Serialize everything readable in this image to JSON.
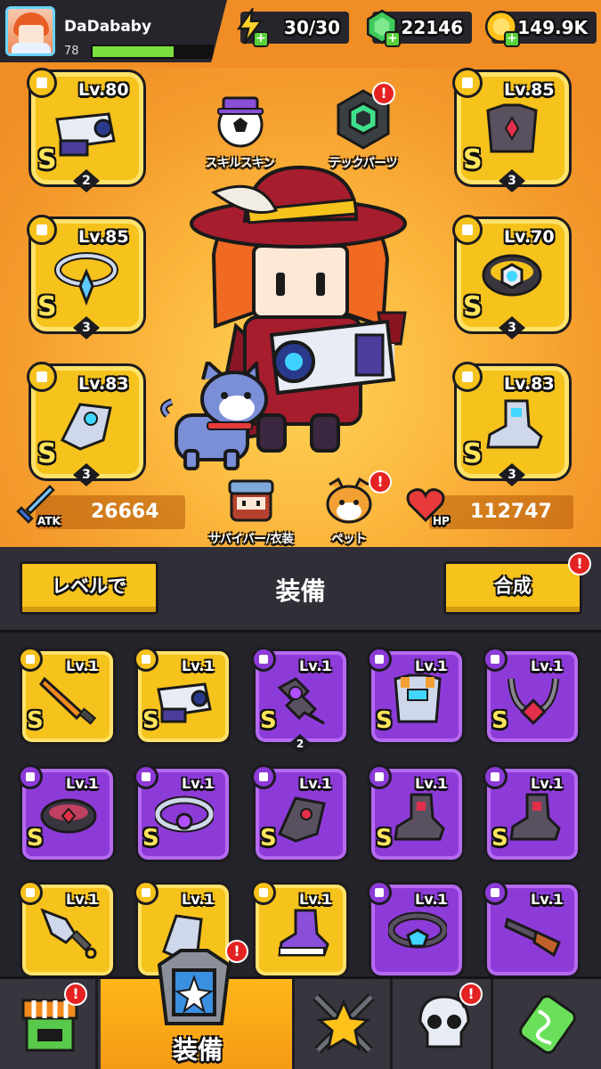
{
  "player": {
    "name": "DaDababy",
    "level": "78",
    "xp_fraction": 0.68
  },
  "currencies": {
    "energy": "30/30",
    "gems": "22146",
    "gold": "149.9K"
  },
  "equipped": [
    {
      "slot": "weapon",
      "level": "Lv.80",
      "grade": "S",
      "stars": "2",
      "item_icon": "blaster-gun-icon"
    },
    {
      "slot": "armor",
      "level": "Lv.85",
      "grade": "S",
      "stars": "3",
      "item_icon": "dark-armor-icon"
    },
    {
      "slot": "necklace",
      "level": "Lv.85",
      "grade": "S",
      "stars": "3",
      "item_icon": "star-necklace-icon"
    },
    {
      "slot": "belt",
      "level": "Lv.70",
      "grade": "S",
      "stars": "3",
      "item_icon": "tech-belt-icon"
    },
    {
      "slot": "gloves",
      "level": "Lv.83",
      "grade": "S",
      "stars": "3",
      "item_icon": "mech-glove-icon"
    },
    {
      "slot": "boots",
      "level": "Lv.83",
      "grade": "S",
      "stars": "3",
      "item_icon": "tech-boots-icon"
    }
  ],
  "hud": {
    "skill_skin": "スキルスキン",
    "tech_parts": "テックパーツ",
    "survivor_costume": "サバイバー/衣装",
    "pet": "ペット",
    "alert": "!"
  },
  "stats": {
    "atk_label": "ATK",
    "atk": "26664",
    "hp_label": "HP",
    "hp": "112747"
  },
  "midbar": {
    "level_button": "レベルで",
    "title": "装備",
    "merge_button": "合成"
  },
  "inventory": [
    {
      "rarity": "gold",
      "level": "Lv.1",
      "grade": "S",
      "item_icon": "katana-icon"
    },
    {
      "rarity": "gold",
      "level": "Lv.1",
      "grade": "S",
      "item_icon": "blaster-gun-icon"
    },
    {
      "rarity": "purple",
      "level": "Lv.1",
      "grade": "S",
      "stars": "2",
      "item_icon": "spiked-blade-icon"
    },
    {
      "rarity": "purple",
      "level": "Lv.1",
      "grade": "S",
      "item_icon": "mech-armor-icon"
    },
    {
      "rarity": "purple",
      "level": "Lv.1",
      "grade": "S",
      "item_icon": "chain-necklace-icon"
    },
    {
      "rarity": "purple",
      "level": "Lv.1",
      "grade": "S",
      "item_icon": "dark-belt-icon"
    },
    {
      "rarity": "purple",
      "level": "Lv.1",
      "grade": "S",
      "item_icon": "gem-belt-icon"
    },
    {
      "rarity": "purple",
      "level": "Lv.1",
      "grade": "S",
      "item_icon": "claw-glove-icon"
    },
    {
      "rarity": "purple",
      "level": "Lv.1",
      "grade": "S",
      "item_icon": "dark-boots-icon"
    },
    {
      "rarity": "purple",
      "level": "Lv.1",
      "grade": "S",
      "item_icon": "dark-boots-icon"
    },
    {
      "rarity": "gold",
      "level": "Lv.1",
      "grade": "",
      "item_icon": "kunai-icon"
    },
    {
      "rarity": "gold",
      "level": "Lv.1",
      "grade": "",
      "item_icon": "metal-glove-icon"
    },
    {
      "rarity": "gold",
      "level": "Lv.1",
      "grade": "",
      "item_icon": "purple-boots-icon"
    },
    {
      "rarity": "purple",
      "level": "Lv.1",
      "grade": "",
      "item_icon": "gem-belt-icon"
    },
    {
      "rarity": "purple",
      "level": "Lv.1",
      "grade": "",
      "item_icon": "shotgun-icon"
    }
  ],
  "nav": {
    "shop": "shop-icon",
    "equipment_label": "装備",
    "battle": "crossed-swords-star-icon",
    "challenge": "skull-icon",
    "evolve": "dna-battery-icon"
  },
  "colors": {
    "gold_frame": "#f6c21c",
    "purple_frame": "#8d3bd8",
    "background_orange": "#f08d24",
    "alert_red": "#e52222"
  }
}
